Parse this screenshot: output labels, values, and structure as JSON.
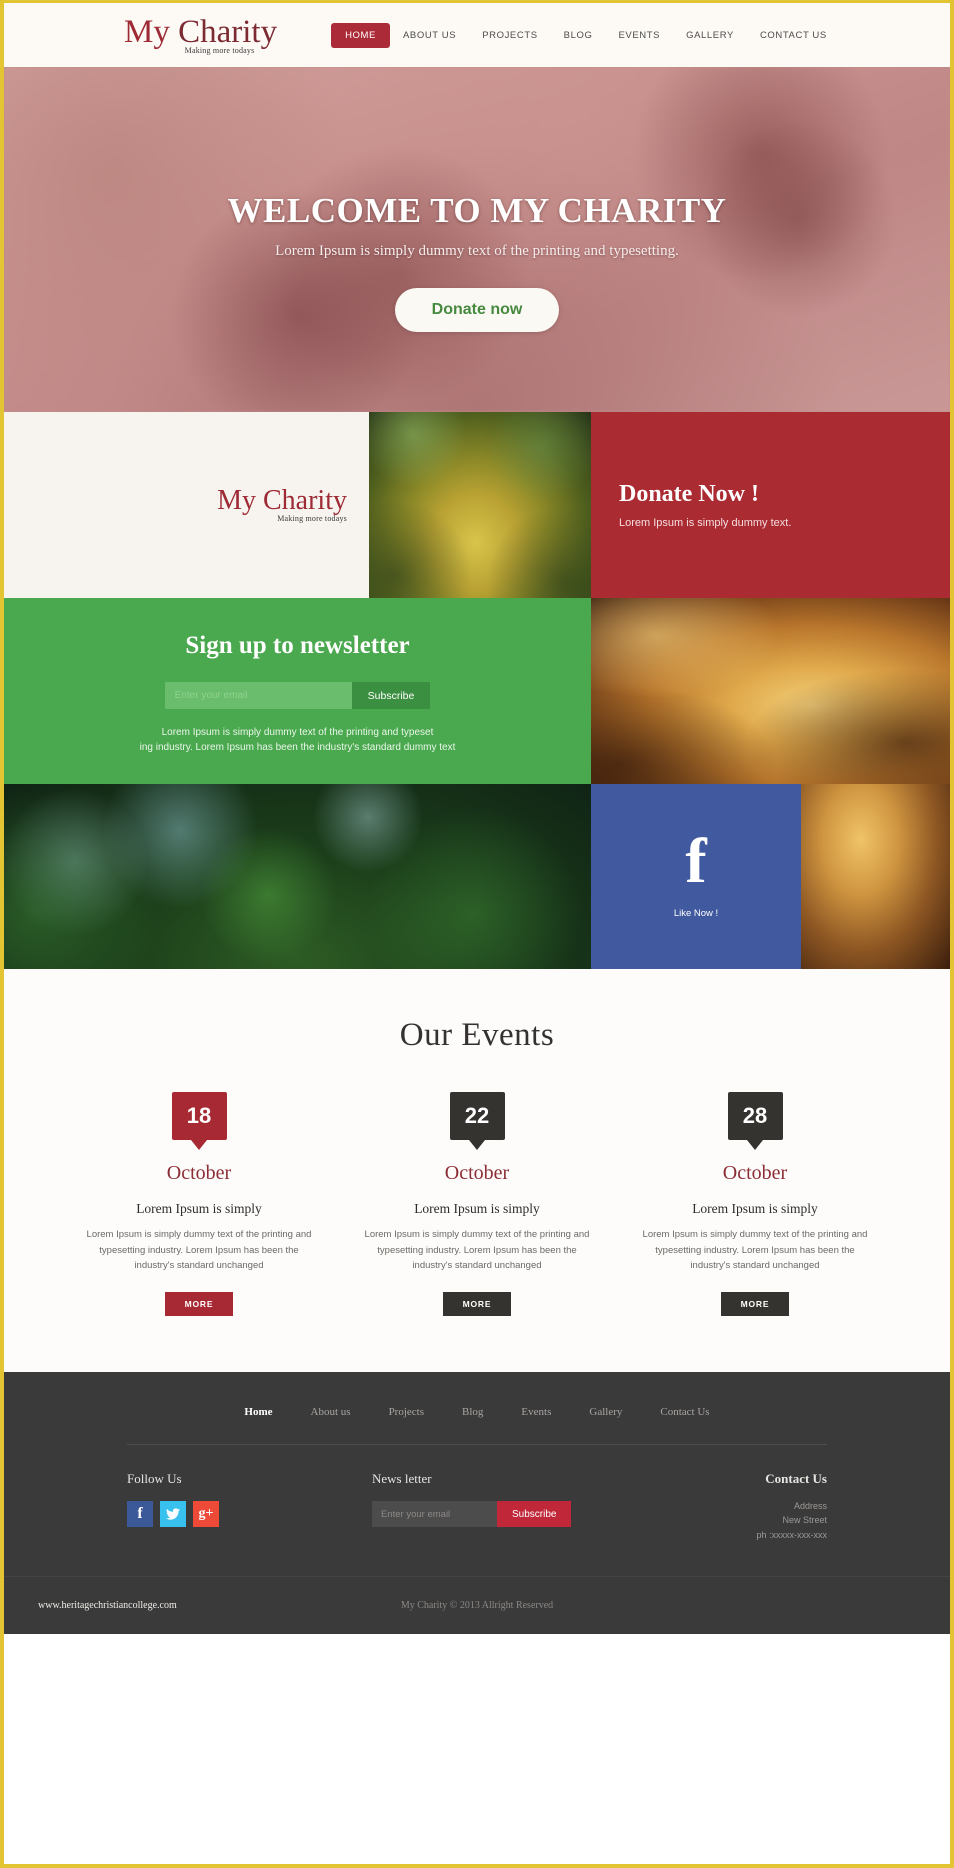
{
  "theme": {
    "accent_red": "#ab2b33",
    "accent_green": "#4aa84f",
    "accent_yellow_border": "#e3c534",
    "dark_footer": "#3a3a3a",
    "facebook_blue": "#41599f"
  },
  "header": {
    "logo_main_my": "My",
    "logo_main_charity": "Charity",
    "logo_sub": "Making more todays",
    "nav": [
      {
        "label": "HOME",
        "active": true
      },
      {
        "label": "ABOUT US",
        "active": false
      },
      {
        "label": "PROJECTS",
        "active": false
      },
      {
        "label": "BLOG",
        "active": false
      },
      {
        "label": "EVENTS",
        "active": false
      },
      {
        "label": "GALLERY",
        "active": false
      },
      {
        "label": "CONTACT US",
        "active": false
      }
    ]
  },
  "hero": {
    "title": "WELCOME TO MY CHARITY",
    "subtitle": "Lorem Ipsum is simply dummy text of the printing and typesetting.",
    "button_label": "Donate now"
  },
  "band_logo": {
    "logo_main_my": "My",
    "logo_main_charity": "Charity",
    "logo_sub": "Making more todays"
  },
  "band_donate": {
    "title": "Donate Now !",
    "subtitle": "Lorem Ipsum is simply dummy text."
  },
  "newsletter": {
    "title": "Sign up to newsletter",
    "input_placeholder": "Enter your email",
    "input_value": "",
    "button_label": "Subscribe",
    "description_line1": "Lorem Ipsum is simply dummy text of the printing and typeset",
    "description_line2": "ing industry. Lorem Ipsum has been the industry's standard dummy text"
  },
  "facebook_panel": {
    "icon": "facebook-f-icon",
    "glyph": "f",
    "label": "Like Now !"
  },
  "events": {
    "section_title": "Our Events",
    "cards": [
      {
        "day": "18",
        "month": "October",
        "heading": "Lorem Ipsum is simply",
        "description": "Lorem Ipsum is simply dummy text of the printing and typesetting industry. Lorem Ipsum has been the industry's standard unchanged",
        "button_label": "MORE",
        "badge_color": "#a62934",
        "button_color": "#a62934"
      },
      {
        "day": "22",
        "month": "October",
        "heading": "Lorem Ipsum is simply",
        "description": "Lorem Ipsum is simply dummy text of the printing and typesetting industry. Lorem Ipsum has been the industry's standard unchanged",
        "button_label": "MORE",
        "badge_color": "#35332f",
        "button_color": "#35332f"
      },
      {
        "day": "28",
        "month": "October",
        "heading": "Lorem Ipsum is simply",
        "description": "Lorem Ipsum is simply dummy text of the printing and typesetting industry. Lorem Ipsum has been the industry's standard unchanged",
        "button_label": "MORE",
        "badge_color": "#35332f",
        "button_color": "#35332f"
      }
    ]
  },
  "footer": {
    "nav": [
      {
        "label": "Home",
        "active": true
      },
      {
        "label": "About us",
        "active": false
      },
      {
        "label": "Projects",
        "active": false
      },
      {
        "label": "Blog",
        "active": false
      },
      {
        "label": "Events",
        "active": false
      },
      {
        "label": "Gallery",
        "active": false
      },
      {
        "label": "Contact Us",
        "active": false
      }
    ],
    "follow": {
      "title": "Follow Us",
      "socials": [
        {
          "name": "facebook-icon",
          "glyph": "f"
        },
        {
          "name": "twitter-icon",
          "glyph": "t"
        },
        {
          "name": "google-plus-icon",
          "glyph": "g+"
        }
      ]
    },
    "newsletter": {
      "title": "News letter",
      "input_placeholder": "Enter your email",
      "input_value": "",
      "button_label": "Subscribe"
    },
    "contact": {
      "title": "Contact Us",
      "line1": "Address",
      "line2": "New Street",
      "line3": "ph :xxxxx-xxx-xxx"
    },
    "bottom": {
      "website": "www.heritagechristiancollege.com",
      "copyright": "My Charity © 2013 Allright Reserved"
    }
  }
}
